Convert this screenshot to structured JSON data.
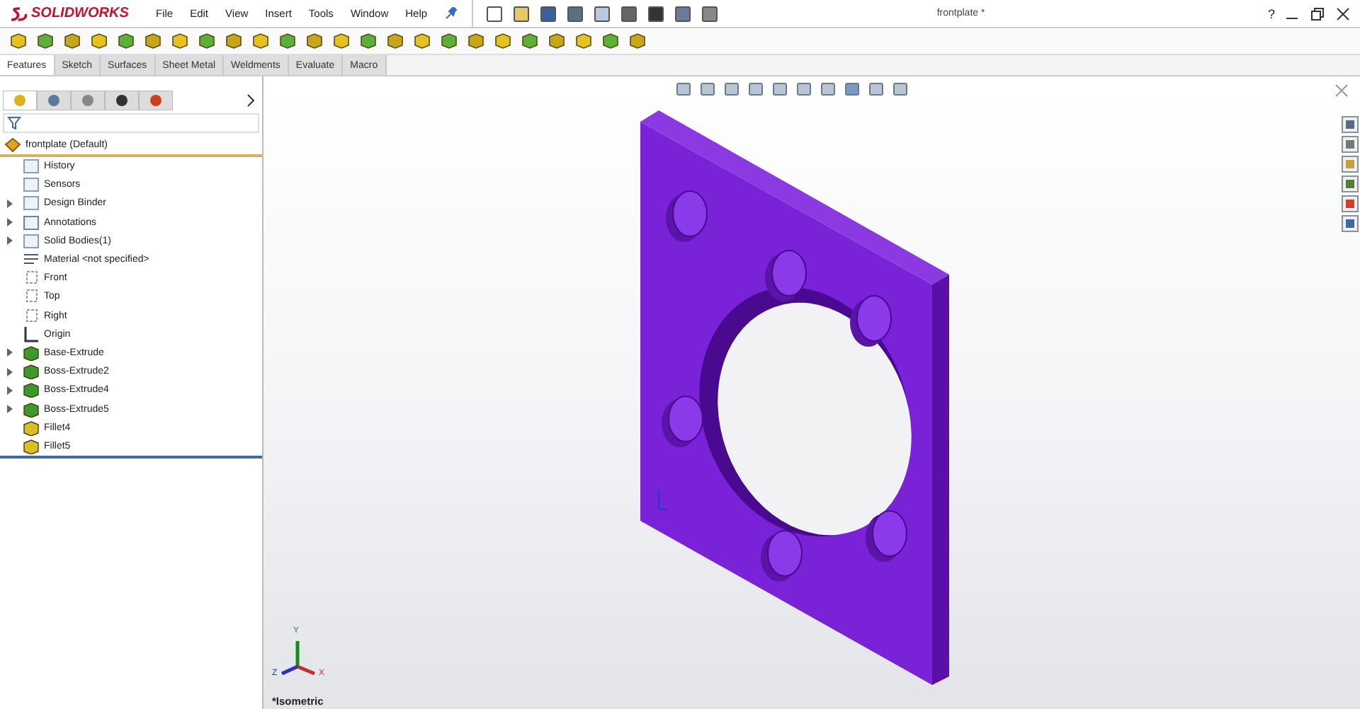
{
  "app": {
    "logo": "SOLIDWORKS"
  },
  "menu": [
    "File",
    "Edit",
    "View",
    "Insert",
    "Tools",
    "Window",
    "Help"
  ],
  "window": {
    "title": "frontplate *",
    "help": "?"
  },
  "tabs": [
    {
      "label": "Features",
      "selected": true
    },
    {
      "label": "Sketch",
      "selected": false
    },
    {
      "label": "Surfaces",
      "selected": false
    },
    {
      "label": "Sheet Metal",
      "selected": false
    },
    {
      "label": "Weldments",
      "selected": false
    },
    {
      "label": "Evaluate",
      "selected": false
    },
    {
      "label": "Macro",
      "selected": false
    }
  ],
  "panel_tabs": [
    {
      "selected": true
    },
    {
      "selected": false
    },
    {
      "selected": false
    },
    {
      "selected": false
    },
    {
      "selected": false
    }
  ],
  "tree": {
    "root": "frontplate  (Default)",
    "items": [
      {
        "label": "History",
        "kind": "folder",
        "collapsed": false
      },
      {
        "label": "Sensors",
        "kind": "folder",
        "collapsed": false
      },
      {
        "label": "Design Binder",
        "kind": "folder",
        "collapsed": true
      },
      {
        "label": "Annotations",
        "kind": "annotation",
        "collapsed": true
      },
      {
        "label": "Solid Bodies(1)",
        "kind": "folder",
        "collapsed": true
      },
      {
        "label": "Material <not specified>",
        "kind": "material",
        "collapsed": false
      },
      {
        "label": "Front",
        "kind": "plane",
        "collapsed": false
      },
      {
        "label": "Top",
        "kind": "plane",
        "collapsed": false
      },
      {
        "label": "Right",
        "kind": "plane",
        "collapsed": false
      },
      {
        "label": "Origin",
        "kind": "origin",
        "collapsed": false
      },
      {
        "label": "Base-Extrude",
        "kind": "extrude",
        "collapsed": true
      },
      {
        "label": "Boss-Extrude2",
        "kind": "extrude",
        "collapsed": true
      },
      {
        "label": "Boss-Extrude4",
        "kind": "extrude",
        "collapsed": true
      },
      {
        "label": "Boss-Extrude5",
        "kind": "extrude",
        "collapsed": true
      },
      {
        "label": "Fillet4",
        "kind": "fillet",
        "collapsed": false
      },
      {
        "label": "Fillet5",
        "kind": "fillet",
        "collapsed": false
      }
    ]
  },
  "viewport": {
    "view_name": "*Isometric",
    "triad": {
      "x": "X",
      "y": "Y",
      "z": "Z"
    }
  }
}
